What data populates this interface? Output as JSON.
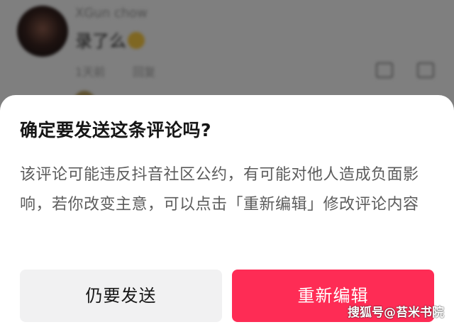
{
  "background": {
    "username": "XGun chow",
    "comment_text": "录了么",
    "meta_time": "1天前",
    "meta_reply": "回复"
  },
  "dialog": {
    "title": "确定要发送这条评论吗?",
    "message": "该评论可能违反抖音社区公约，有可能对他人造成负面影响，若你改变主意，可以点击「重新编辑」修改评论内容",
    "send_anyway_label": "仍要发送",
    "reedit_label": "重新编辑"
  },
  "watermark": "搜狐号@苔米书院",
  "colors": {
    "accent": "#fe2c55",
    "secondary_button": "#f1f1f2",
    "title_text": "#161616",
    "body_text": "#5c5c5c"
  }
}
